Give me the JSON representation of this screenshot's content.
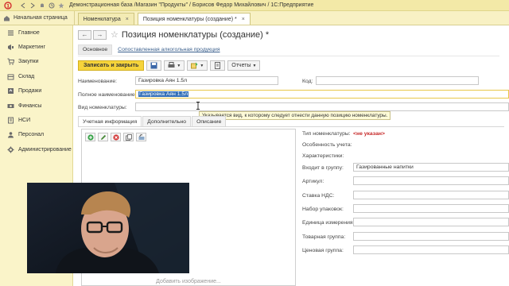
{
  "titlebar": {
    "title": "Демонстрационная база /Магазин \"Продукты\" / Борисов Федор Михайлович / 1С:Предприятие"
  },
  "tabs": {
    "home": "Начальная страница",
    "items": [
      {
        "label": "Номенклатура"
      },
      {
        "label": "Позиция номенклатуры (создание) *"
      }
    ]
  },
  "sidebar": {
    "items": [
      {
        "label": "Главное",
        "icon": "menu-icon"
      },
      {
        "label": "Маркетинг",
        "icon": "marketing-icon"
      },
      {
        "label": "Закупки",
        "icon": "purchases-icon"
      },
      {
        "label": "Склад",
        "icon": "warehouse-icon"
      },
      {
        "label": "Продажи",
        "icon": "sales-icon"
      },
      {
        "label": "Финансы",
        "icon": "finance-icon"
      },
      {
        "label": "НСИ",
        "icon": "reference-icon"
      },
      {
        "label": "Персонал",
        "icon": "staff-icon"
      },
      {
        "label": "Администрирование",
        "icon": "admin-icon"
      }
    ]
  },
  "form": {
    "title": "Позиция номенклатуры (создание) *",
    "subtabs": [
      "Основное",
      "Сопоставленная алкогольная продукция"
    ],
    "toolbar": {
      "save_close": "Записать и закрыть",
      "reports": "Отчеты"
    },
    "fields": {
      "name_label": "Наименование:",
      "name_value": "Газировка Аян 1.5л",
      "code_label": "Код:",
      "code_value": "",
      "full_name_label": "Полное наименование:",
      "full_name_value": "Газировка Аян 1.5л",
      "kind_label": "Вид номенклатуры:",
      "kind_value": ""
    },
    "tooltip": "Указывается вид, к которому следует отнести данную позицию номенклатуры.",
    "detail_tabs": [
      "Учетная информация",
      "Дополнительно",
      "Описание"
    ],
    "add_image": "Добавить изображение...",
    "right": {
      "type_label": "Тип номенклатуры:",
      "type_value": "<не указан>",
      "features_label": "Особенность учета:",
      "chars_label": "Характеристики:",
      "group_label": "Входит в группу:",
      "group_value": "Газированные напитки",
      "article_label": "Артикул:",
      "vat_label": "Ставка НДС:",
      "pack_label": "Набор упаковок:",
      "unit_label": "Единица измерения:",
      "goods_group_label": "Товарная группа:",
      "price_group_label": "Ценовая группа:"
    }
  },
  "colors": {
    "title_bar": "#f3e9a7",
    "sidebar": "#faf4c9",
    "primary_button": "#f6d43b",
    "selection": "#3470b8",
    "not_set": "#c62828"
  }
}
